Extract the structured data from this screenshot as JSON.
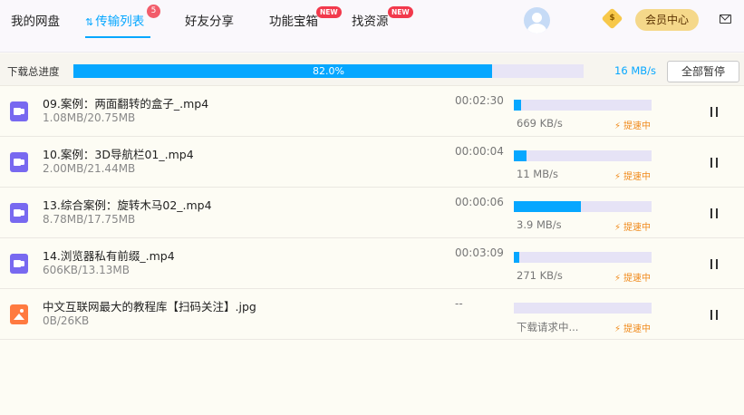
{
  "header": {
    "tabs": [
      {
        "label": "我的网盘"
      },
      {
        "label": "传输列表",
        "badge": "5",
        "icon": "transfer-icon"
      },
      {
        "label": "好友分享"
      },
      {
        "label": "功能宝箱",
        "badge": "NEW"
      },
      {
        "label": "找资源",
        "badge": "NEW"
      }
    ],
    "coin_icon": "$",
    "vip_label": "会员中心",
    "mail_icon": "mail-icon"
  },
  "overall": {
    "label": "下载总进度",
    "progress": 0.82,
    "percent_text": "82.0%",
    "speed": "16 MB/s",
    "pause_all": "全部暂停"
  },
  "files": [
    {
      "name": "09.案例：两面翻转的盒子_.mp4",
      "size": "1.08MB/20.75MB",
      "time": "00:02:30",
      "progress": 0.05,
      "speed": "669 KB/s",
      "boost": "提速中",
      "type": "video"
    },
    {
      "name": "10.案例：3D导航栏01_.mp4",
      "size": "2.00MB/21.44MB",
      "time": "00:00:04",
      "progress": 0.09,
      "speed": "11 MB/s",
      "boost": "提速中",
      "type": "video"
    },
    {
      "name": "13.综合案例：旋转木马02_.mp4",
      "size": "8.78MB/17.75MB",
      "time": "00:00:06",
      "progress": 0.49,
      "speed": "3.9 MB/s",
      "boost": "提速中",
      "type": "video"
    },
    {
      "name": "14.浏览器私有前缀_.mp4",
      "size": "606KB/13.13MB",
      "time": "00:03:09",
      "progress": 0.04,
      "speed": "271 KB/s",
      "boost": "提速中",
      "type": "video"
    },
    {
      "name": "中文互联网最大的教程库【扫码关注】.jpg",
      "size": "0B/26KB",
      "time": "--",
      "progress": 0.0,
      "speed": "下载请求中...",
      "boost": "提速中",
      "type": "image"
    }
  ],
  "colors": {
    "accent": "#06a7ff",
    "boost": "#f08a1c",
    "badge": "#f2394c"
  }
}
